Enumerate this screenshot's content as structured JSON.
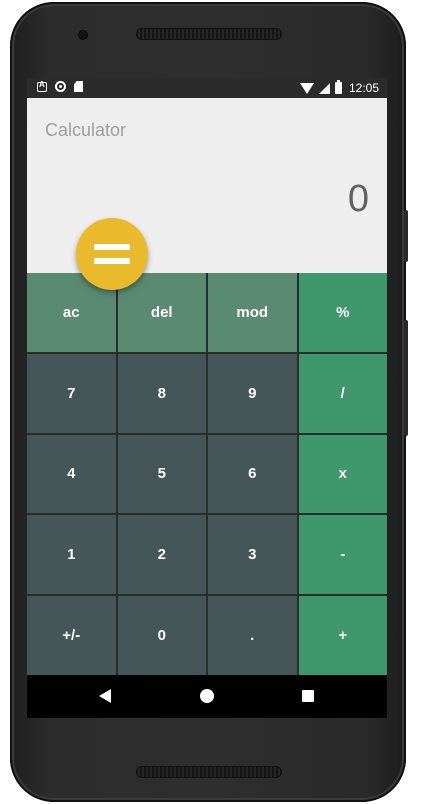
{
  "status_bar": {
    "time": "12:05",
    "left_icons": [
      "a-notification-icon",
      "circle-notification-icon",
      "sd-card-icon"
    ],
    "right_icons": [
      "wifi-icon",
      "cell-signal-icon",
      "battery-charging-icon"
    ]
  },
  "app": {
    "title": "Calculator",
    "result": "0",
    "equals_icon": "equals-icon"
  },
  "keypad": {
    "rows": [
      [
        {
          "label": "ac",
          "kind": "fn"
        },
        {
          "label": "del",
          "kind": "fn"
        },
        {
          "label": "mod",
          "kind": "fn"
        },
        {
          "label": "%",
          "kind": "op"
        }
      ],
      [
        {
          "label": "7",
          "kind": "num"
        },
        {
          "label": "8",
          "kind": "num"
        },
        {
          "label": "9",
          "kind": "num"
        },
        {
          "label": "/",
          "kind": "op"
        }
      ],
      [
        {
          "label": "4",
          "kind": "num"
        },
        {
          "label": "5",
          "kind": "num"
        },
        {
          "label": "6",
          "kind": "num"
        },
        {
          "label": "x",
          "kind": "op"
        }
      ],
      [
        {
          "label": "1",
          "kind": "num"
        },
        {
          "label": "2",
          "kind": "num"
        },
        {
          "label": "3",
          "kind": "num"
        },
        {
          "label": "-",
          "kind": "op"
        }
      ],
      [
        {
          "label": "+/-",
          "kind": "num"
        },
        {
          "label": "0",
          "kind": "num"
        },
        {
          "label": ".",
          "kind": "num"
        },
        {
          "label": "+",
          "kind": "op"
        }
      ]
    ]
  },
  "navbar": {
    "icons": [
      "back-icon",
      "home-icon",
      "recents-icon"
    ]
  },
  "colors": {
    "function_key": "#5b8a73",
    "number_key": "#445658",
    "operator_key": "#3e986c",
    "equals_button": "#e9bb2c",
    "display_background": "#eeeeee"
  }
}
